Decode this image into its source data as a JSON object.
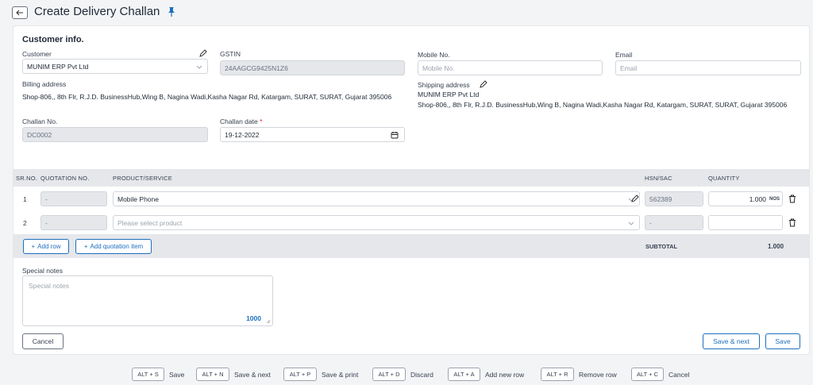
{
  "header": {
    "title": "Create Delivery Challan",
    "back_icon": "arrow-left-icon",
    "pin_icon": "pin-icon"
  },
  "customer_info": {
    "section_title": "Customer info.",
    "customer": {
      "label": "Customer",
      "value": "MUNIM ERP Pvt Ltd"
    },
    "gstin": {
      "label": "GSTIN",
      "value": "24AAGCG9425N1Z6"
    },
    "mobile": {
      "label": "Mobile No.",
      "placeholder": "Mobile No."
    },
    "email": {
      "label": "Email",
      "placeholder": "Email"
    },
    "billing": {
      "label": "Billing address",
      "value": "Shop-806,, 8th Flr, R.J.D. BusinessHub,Wing B, Nagina Wadi,Kasha Nagar Rd, Katargam, SURAT, SURAT, Gujarat 395006"
    },
    "shipping": {
      "label": "Shipping address",
      "name": "MUNIM ERP Pvt Ltd",
      "value": "Shop-806,, 8th Flr, R.J.D. BusinessHub,Wing B, Nagina Wadi,Kasha Nagar Rd, Katargam, SURAT, SURAT, Gujarat 395006"
    },
    "challan_no": {
      "label": "Challan No.",
      "value": "DC0002"
    },
    "challan_date": {
      "label": "Challan date",
      "required_mark": "*",
      "value": "19-12-2022"
    }
  },
  "table": {
    "headers": {
      "srno": "SR.NO.",
      "quotation": "QUOTATION NO.",
      "product": "PRODUCT/SERVICE",
      "hsn": "HSN/SAC",
      "quantity": "QUANTITY"
    },
    "rows": [
      {
        "srno": "1",
        "quotation": "-",
        "product": "Mobile Phone",
        "hsn": "562389",
        "quantity": "1.000",
        "unit": "NOS"
      },
      {
        "srno": "2",
        "quotation": "-",
        "product_placeholder": "Please select product",
        "hsn": "-",
        "quantity": ""
      }
    ],
    "add_row_label": "Add row",
    "add_quotation_label": "Add quotation item",
    "subtotal_label": "SUBTOTAL",
    "subtotal_value": "1.000"
  },
  "notes": {
    "label": "Special notes",
    "placeholder": "Special notes",
    "char_count": "1000"
  },
  "actions": {
    "cancel": "Cancel",
    "save_next": "Save & next",
    "save": "Save"
  },
  "shortcuts": [
    {
      "key": "ALT + S",
      "label": "Save"
    },
    {
      "key": "ALT + N",
      "label": "Save & next"
    },
    {
      "key": "ALT + P",
      "label": "Save & print"
    },
    {
      "key": "ALT + D",
      "label": "Discard"
    },
    {
      "key": "ALT + A",
      "label": "Add new row"
    },
    {
      "key": "ALT + R",
      "label": "Remove row"
    },
    {
      "key": "ALT + C",
      "label": "Cancel"
    }
  ],
  "colors": {
    "accent": "#1d6fbf",
    "required": "#dc2626",
    "disabled_bg": "#e5e7eb"
  }
}
